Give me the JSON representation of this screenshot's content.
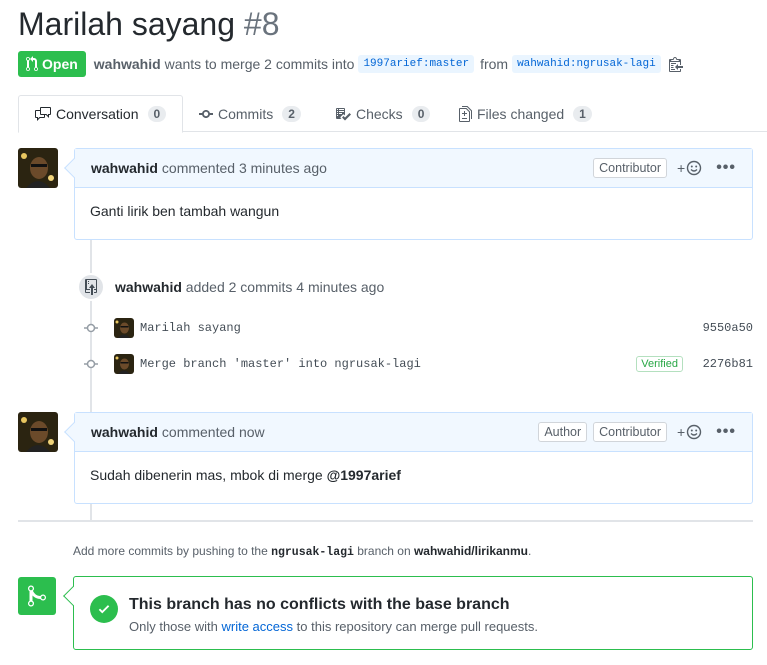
{
  "pr": {
    "title": "Marilah sayang",
    "number": "#8",
    "state": "Open",
    "author": "wahwahid",
    "summary_mid": "wants to merge 2 commits into",
    "base_branch": "1997arief:master",
    "from_text": "from",
    "head_branch": "wahwahid:ngrusak-lagi"
  },
  "tabs": [
    {
      "label": "Conversation",
      "count": "0",
      "icon": "conversation-icon"
    },
    {
      "label": "Commits",
      "count": "2",
      "icon": "commit-icon"
    },
    {
      "label": "Checks",
      "count": "0",
      "icon": "checklist-icon"
    },
    {
      "label": "Files changed",
      "count": "1",
      "icon": "file-diff-icon"
    }
  ],
  "comments": [
    {
      "author": "wahwahid",
      "time": "commented 3 minutes ago",
      "labels": [
        "Contributor"
      ],
      "body": "Ganti lirik ben tambah wangun"
    },
    {
      "author": "wahwahid",
      "time": "commented now",
      "labels": [
        "Author",
        "Contributor"
      ],
      "body_text": "Sudah dibenerin mas, mbok di merge ",
      "body_mention": "@1997arief"
    }
  ],
  "event": {
    "author": "wahwahid",
    "text": "added 2 commits 4 minutes ago"
  },
  "commits": [
    {
      "message": "Marilah sayang",
      "sha": "9550a50",
      "verified": ""
    },
    {
      "message": "Merge branch 'master' into ngrusak-lagi",
      "sha": "2276b81",
      "verified": "Verified"
    }
  ],
  "hint": {
    "prefix": "Add more commits by pushing to the ",
    "branch": "ngrusak-lagi",
    "middle": " branch on ",
    "repo": "wahwahid/lirikanmu",
    "suffix": "."
  },
  "merge": {
    "title": "This branch has no conflicts with the base branch",
    "sub_prefix": "Only those with ",
    "sub_link": "write access",
    "sub_suffix": " to this repository can merge pull requests."
  },
  "actions": {
    "add_reaction": "+",
    "more": "•••"
  },
  "colors": {
    "green": "#2cbe4e",
    "blue_link": "#0366d6",
    "comment_border": "#c8e1ff",
    "header_bg": "#f1f8ff"
  }
}
